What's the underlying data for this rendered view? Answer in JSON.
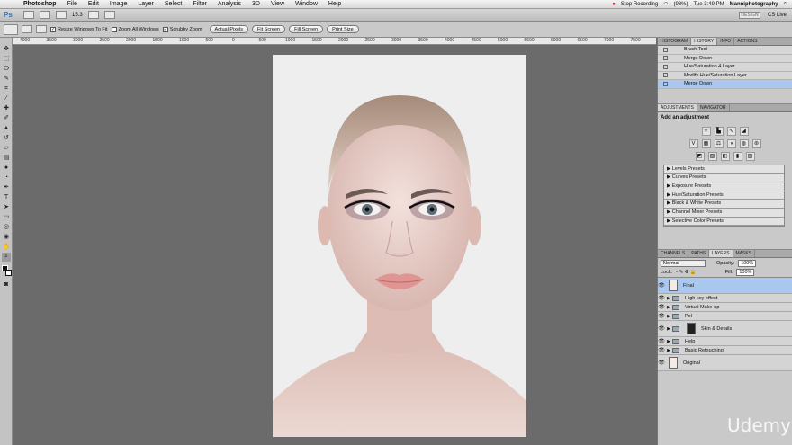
{
  "menubar": {
    "app": "Photoshop",
    "items": [
      "File",
      "Edit",
      "Image",
      "Layer",
      "Select",
      "Filter",
      "Analysis",
      "3D",
      "View",
      "Window",
      "Help"
    ],
    "status": "Stop Recording",
    "battery": "(98%)",
    "clock": "Tue 3:49 PM",
    "user": "Manniphotography"
  },
  "appbar": {
    "logo": "Ps",
    "zoom": "15.3",
    "workspace": "DESIGN",
    "cslive": "CS Live"
  },
  "options": {
    "resize_windows": "Resize Windows To Fit",
    "zoom_all": "Zoom All Windows",
    "scrubby": "Scrubby Zoom",
    "actual_pixels": "Actual Pixels",
    "fit_screen": "Fit Screen",
    "fill_screen": "Fill Screen",
    "print_size": "Print Size"
  },
  "ruler": {
    "labels": [
      "4000",
      "3500",
      "3000",
      "2500",
      "2000",
      "1500",
      "1000",
      "500",
      "0",
      "500",
      "1000",
      "1500",
      "2000",
      "2500",
      "3000",
      "3500",
      "4000",
      "4500",
      "5000",
      "5500",
      "6000",
      "6500",
      "7000",
      "7500"
    ]
  },
  "history": {
    "tabs": [
      "HISTOGRAM",
      "HISTORY",
      "INFO",
      "ACTIONS"
    ],
    "items": [
      "Brush Tool",
      "Merge Down",
      "Hue/Saturation 4 Layer",
      "Modify Hue/Saturation Layer",
      "Merge Down"
    ]
  },
  "adjustments": {
    "tabs": [
      "ADJUSTMENTS",
      "NAVIGATOR"
    ],
    "title": "Add an adjustment",
    "presets": [
      "Levels Presets",
      "Curves Presets",
      "Exposure Presets",
      "Hue/Saturation Presets",
      "Black & White Presets",
      "Channel Mixer Presets",
      "Selective Color Presets"
    ]
  },
  "layers": {
    "tabs": [
      "CHANNELS",
      "PATHS",
      "LAYERS",
      "MASKS"
    ],
    "blend_mode": "Normal",
    "opacity_label": "Opacity:",
    "opacity": "100%",
    "lock_label": "Lock:",
    "fill_label": "Fill:",
    "fill": "100%",
    "items": [
      "Final",
      "High key effect",
      "Virtual Make-up",
      "Pel",
      "Skin & Details",
      "Help",
      "Basic Retouching",
      "Original"
    ]
  },
  "watermark": "Udemy"
}
